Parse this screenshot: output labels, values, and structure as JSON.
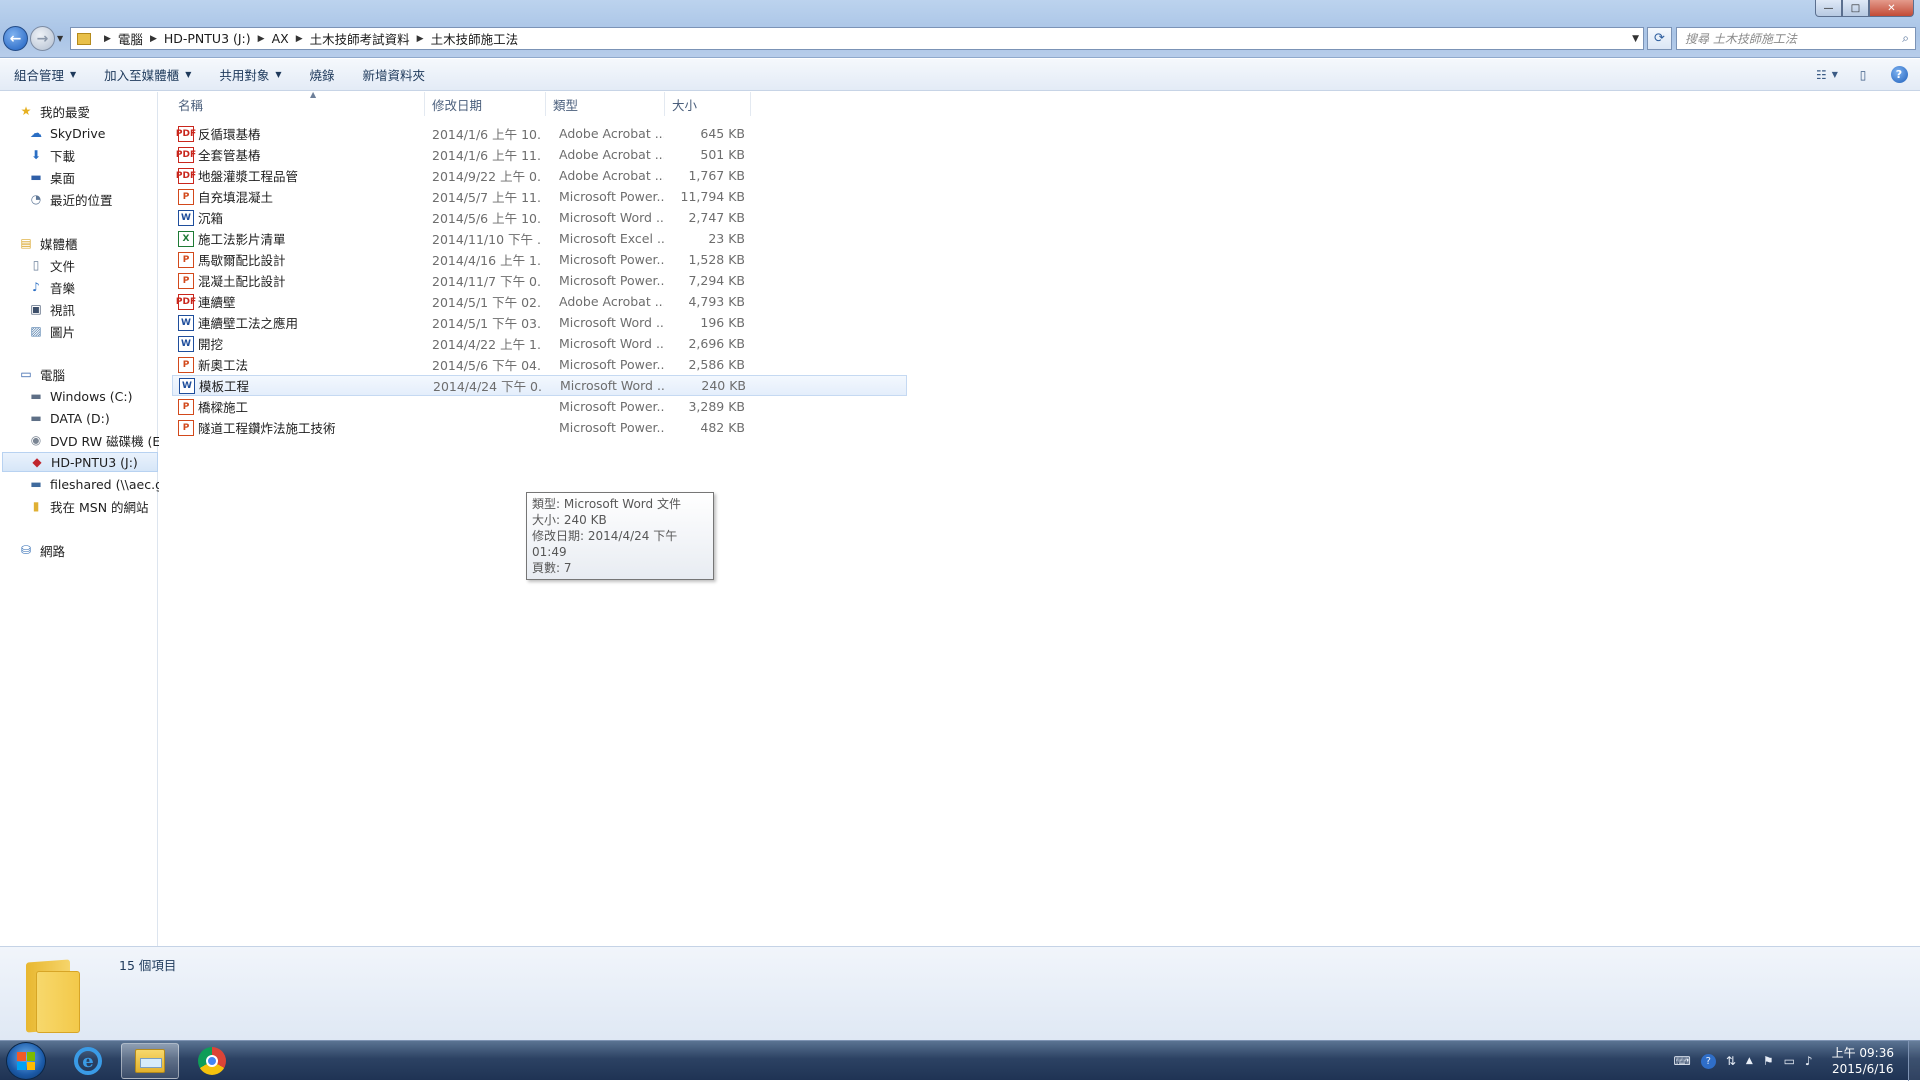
{
  "window": {
    "controls": {
      "minimize": "—",
      "maximize": "□",
      "close": "✕"
    }
  },
  "nav": {
    "back": "←",
    "forward": "→",
    "history_dropdown": "▼"
  },
  "address": {
    "crumbs": [
      "電腦",
      "HD-PNTU3 (J:)",
      "AX",
      "土木技師考試資料",
      "土木技師施工法"
    ],
    "separator": "▶",
    "dropdown": "▼",
    "refresh": "⟳"
  },
  "search": {
    "placeholder": "搜尋 土木技師施工法",
    "icon": "⌕"
  },
  "toolbar": {
    "organize": "組合管理",
    "add_to_library": "加入至媒體櫃",
    "share_with": "共用對象",
    "burn": "燒錄",
    "new_folder": "新增資料夾",
    "dropdown": "▼",
    "views_icon": "☷",
    "preview_icon": "▯",
    "help": "?"
  },
  "sidebar": {
    "favorites": {
      "label": "我的最愛",
      "icon": "★",
      "items": [
        {
          "label": "SkyDrive",
          "icon": "☁"
        },
        {
          "label": "下載",
          "icon": "⬇"
        },
        {
          "label": "桌面",
          "icon": "▬"
        },
        {
          "label": "最近的位置",
          "icon": "◔"
        }
      ]
    },
    "libraries": {
      "label": "媒體櫃",
      "icon": "▤",
      "items": [
        {
          "label": "文件",
          "icon": "▯"
        },
        {
          "label": "音樂",
          "icon": "♪"
        },
        {
          "label": "視訊",
          "icon": "▣"
        },
        {
          "label": "圖片",
          "icon": "▨"
        }
      ]
    },
    "computer": {
      "label": "電腦",
      "icon": "▭",
      "items": [
        {
          "label": "Windows (C:)",
          "icon": "▬"
        },
        {
          "label": "DATA (D:)",
          "icon": "▬"
        },
        {
          "label": "DVD RW 磁碟機 (E:)",
          "icon": "◉"
        },
        {
          "label": "HD-PNTU3 (J:)",
          "icon": "◆"
        },
        {
          "label": "fileshared (\\\\aec.gov.tw)",
          "icon": "▬"
        },
        {
          "label": "我在 MSN 的網站",
          "icon": "▮"
        }
      ]
    },
    "network": {
      "label": "網路",
      "icon": "⛁"
    }
  },
  "columns": {
    "name": "名稱",
    "modified": "修改日期",
    "type": "類型",
    "size": "大小",
    "sort_indicator": "▲"
  },
  "files": [
    {
      "name": "反循環基樁",
      "date": "2014/1/6 上午 10...",
      "type": "Adobe Acrobat ...",
      "size": "645 KB",
      "kind": "pdf",
      "icon": "PDF"
    },
    {
      "name": "全套管基樁",
      "date": "2014/1/6 上午 11...",
      "type": "Adobe Acrobat ...",
      "size": "501 KB",
      "kind": "pdf",
      "icon": "PDF"
    },
    {
      "name": "地盤灌漿工程品管",
      "date": "2014/9/22 上午 0...",
      "type": "Adobe Acrobat ...",
      "size": "1,767 KB",
      "kind": "pdf",
      "icon": "PDF"
    },
    {
      "name": "自充填混凝土",
      "date": "2014/5/7 上午 11...",
      "type": "Microsoft Power...",
      "size": "11,794 KB",
      "kind": "ppt",
      "icon": "P"
    },
    {
      "name": "沉箱",
      "date": "2014/5/6 上午 10...",
      "type": "Microsoft Word ...",
      "size": "2,747 KB",
      "kind": "doc",
      "icon": "W"
    },
    {
      "name": "施工法影片清單",
      "date": "2014/11/10 下午 ...",
      "type": "Microsoft Excel ...",
      "size": "23 KB",
      "kind": "xls",
      "icon": "X"
    },
    {
      "name": "馬歇爾配比設計",
      "date": "2014/4/16 上午 1...",
      "type": "Microsoft Power...",
      "size": "1,528 KB",
      "kind": "ppt",
      "icon": "P"
    },
    {
      "name": "混凝土配比設計",
      "date": "2014/11/7 下午 0...",
      "type": "Microsoft Power...",
      "size": "7,294 KB",
      "kind": "ppt",
      "icon": "P"
    },
    {
      "name": "連續壁",
      "date": "2014/5/1 下午 02...",
      "type": "Adobe Acrobat ...",
      "size": "4,793 KB",
      "kind": "pdf",
      "icon": "PDF"
    },
    {
      "name": "連續壁工法之應用",
      "date": "2014/5/1 下午 03...",
      "type": "Microsoft Word ...",
      "size": "196 KB",
      "kind": "doc",
      "icon": "W"
    },
    {
      "name": "開挖",
      "date": "2014/4/22 上午 1...",
      "type": "Microsoft Word ...",
      "size": "2,696 KB",
      "kind": "doc",
      "icon": "W"
    },
    {
      "name": "新奧工法",
      "date": "2014/5/6 下午 04...",
      "type": "Microsoft Power...",
      "size": "2,586 KB",
      "kind": "ppt",
      "icon": "P"
    },
    {
      "name": "模板工程",
      "date": "2014/4/24 下午 0...",
      "type": "Microsoft Word ...",
      "size": "240 KB",
      "kind": "doc",
      "icon": "W"
    },
    {
      "name": "橋樑施工",
      "date": "",
      "type": "Microsoft Power...",
      "size": "3,289 KB",
      "kind": "ppt",
      "icon": "P"
    },
    {
      "name": "隧道工程鑽炸法施工技術",
      "date": "",
      "type": "Microsoft Power...",
      "size": "482 KB",
      "kind": "ppt",
      "icon": "P"
    }
  ],
  "tooltip": {
    "type": "類型: Microsoft Word 文件",
    "size": "大小: 240 KB",
    "modified": "修改日期: 2014/4/24 下午 01:49",
    "pages": "頁數: 7"
  },
  "details": {
    "count": "15 個項目"
  },
  "taskbar": {
    "ie_glyph": "e",
    "tray": {
      "keyboard": "⌨",
      "help": "?",
      "network_signal": "⇅",
      "show_hidden": "▲",
      "flag": "⚑",
      "action_center": "▭",
      "volume": "♪"
    },
    "clock": {
      "time": "上午 09:36",
      "date": "2015/6/16"
    }
  }
}
